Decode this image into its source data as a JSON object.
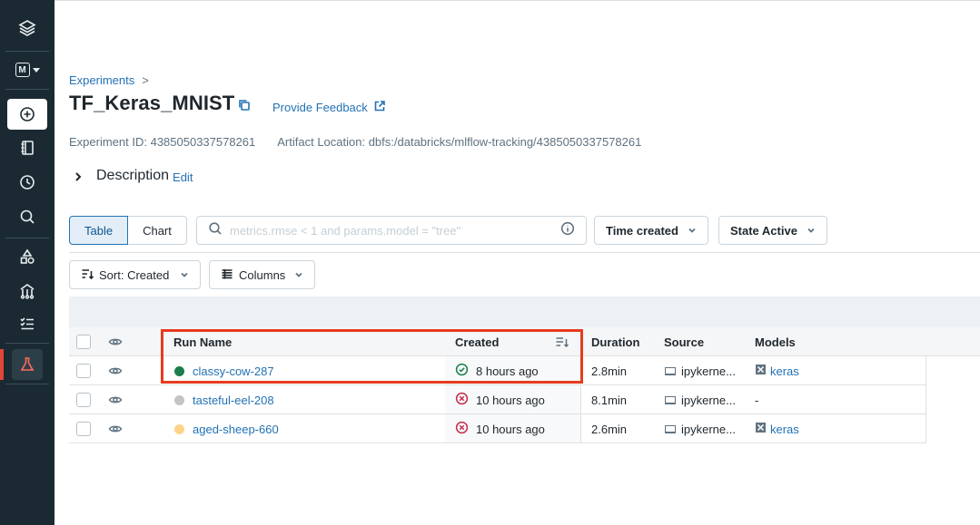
{
  "breadcrumb": {
    "root": "Experiments",
    "separator": ">"
  },
  "page": {
    "title": "TF_Keras_MNIST",
    "feedback_label": "Provide Feedback",
    "experiment_id_label": "Experiment ID: 4385050337578261",
    "artifact_location_label": "Artifact Location: dbfs:/databricks/mlflow-tracking/4385050337578261",
    "description_label": "Description",
    "description_edit": "Edit"
  },
  "sidebar": {
    "workspace_letter": "M",
    "items": [
      "new",
      "workspace",
      "recents",
      "search",
      "models",
      "features",
      "tasks",
      "experiments"
    ]
  },
  "controls": {
    "view_table": "Table",
    "view_chart": "Chart",
    "search_placeholder": "metrics.rmse < 1 and params.model = \"tree\"",
    "time_filter": "Time created",
    "state_filter": "State Active",
    "sort_label": "Sort: Created",
    "columns_label": "Columns"
  },
  "table": {
    "headers": {
      "run_name": "Run Name",
      "created": "Created",
      "duration": "Duration",
      "source": "Source",
      "models": "Models"
    },
    "rows": [
      {
        "name": "classy-cow-287",
        "status_color": "#1b7f4b",
        "status": "success",
        "created": "8 hours ago",
        "duration": "2.8min",
        "source": "ipykerne...",
        "model": "keras"
      },
      {
        "name": "tasteful-eel-208",
        "status_color": "#c4c4c4",
        "status": "failed",
        "created": "10 hours ago",
        "duration": "8.1min",
        "source": "ipykerne...",
        "model": "-"
      },
      {
        "name": "aged-sheep-660",
        "status_color": "#fcd387",
        "status": "failed",
        "created": "10 hours ago",
        "duration": "2.6min",
        "source": "ipykerne...",
        "model": "keras"
      }
    ]
  },
  "colors": {
    "sidebar_bg": "#1b2a32",
    "link": "#2272b4",
    "highlight": "#e63b1f",
    "success": "#1b7f4b",
    "error": "#c82d4c"
  }
}
